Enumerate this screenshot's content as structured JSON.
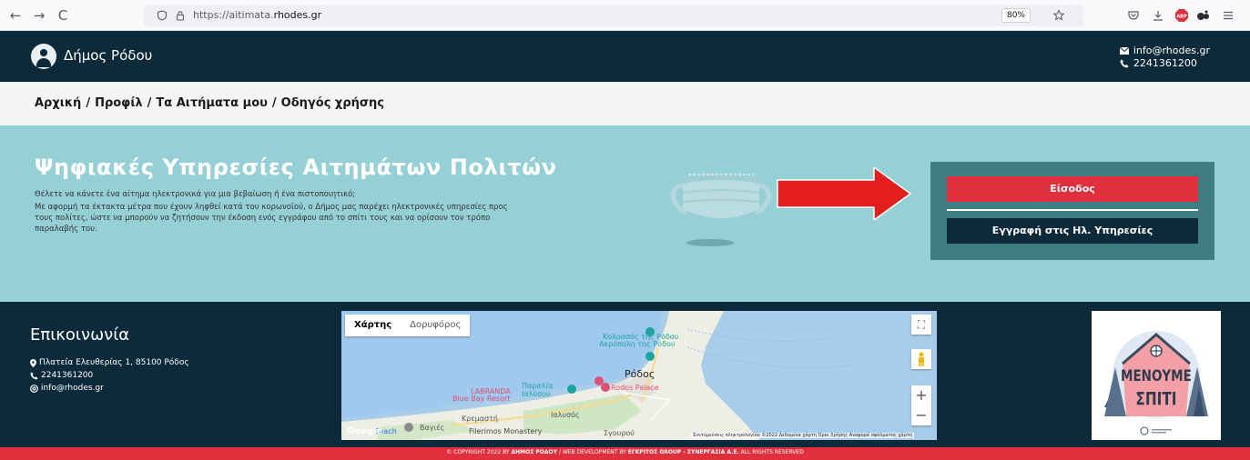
{
  "browser": {
    "url_prefix": "https://aitimata.",
    "url_domain": "rhodes.gr",
    "zoom": "80%",
    "back_icon": "←",
    "forward_icon": "→",
    "reload_icon": "C"
  },
  "header": {
    "brand": "Δήμος Ρόδου",
    "email": "info@rhodes.gr",
    "phone": "2241361200"
  },
  "breadcrumb": {
    "items": [
      "Αρχική",
      "Προφίλ",
      "Τα Αιτήματα μου",
      "Οδηγός χρήσης"
    ],
    "separator": "/"
  },
  "hero": {
    "title": "Ψηφιακές Υπηρεσίες Αιτημάτων Πολιτών",
    "line1": "Θέλετε να κάνετε ένα αίτημα ηλεκτρονικά για μια βεβαίωση ή ένα πιστοποιητικό;",
    "line2": "Με αφορμή τα έκτακτα μέτρα που έχουν ληφθεί κατά του κορωνοϊού, ο Δήμος μας παρέχει ηλεκτρονικές υπηρεσίες προς τους πολίτες, ώστε να μπορούν να ζητήσουν την έκδοση ενός εγγράφου από το σπίτι τους και να ορίσουν τον τρόπο παραλαβής του.",
    "login_label": "Είσοδος",
    "register_label": "Εγγραφή στις Ηλ. Υπηρεσίες"
  },
  "footer": {
    "title": "Επικοινωνία",
    "address": "Πλατεία Ελευθερίας 1, 85100 Ρόδος",
    "phone": "2241361200",
    "email": "info@rhodes.gr",
    "map": {
      "tab_map": "Χάρτης",
      "tab_satellite": "Δορυφόρος",
      "labels": {
        "colossus": "Κολοσσός της Ρόδου",
        "acropolis": "Ακρόπολη της Ρόδου",
        "rodos": "Ρόδος",
        "paralia": "Παραλία",
        "ialyssou": "Ιαλύσου",
        "rodos_palace": "Rodos Palace",
        "labranda": "LABRANDA",
        "blue_bay": "Blue Bay Resort",
        "kremasti": "Κρεμαστή",
        "ialysos": "Ιαλυσός",
        "vagies": "Βαγιές",
        "monastery": "Filerimos Monastery",
        "beach": "Beach",
        "sgourou": "Σγουρού",
        "google": "Google"
      },
      "attribution": "Συντομεύσεις πληκτρολογίου   ©2022 Δεδομένα χάρτη   Όροι Χρήσης   Αναφορά σφάλματος χάρτη",
      "zoom_in": "+",
      "zoom_out": "−"
    },
    "poster_text_1": "ΜΕΝΟΥΜΕ",
    "poster_text_2": "ΣΠΙΤΙ"
  },
  "copyright": {
    "prefix": "© COPYRIGHT 2022 BY ",
    "owner": "ΔΗΜΟΣ ΡΟΔΟΥ",
    "middle": " / WEB DEVELOPMENT BY ",
    "developer": "ΕΓΚΡΙΤΟΣ GROUP - ΣΥΝΕΡΓΑΣΙΑ Α.Ε.",
    "suffix": " ALL RIGHTS RESERVED"
  },
  "colors": {
    "navy": "#0c2a3a",
    "teal": "#95d0d6",
    "red": "#e0303e"
  }
}
